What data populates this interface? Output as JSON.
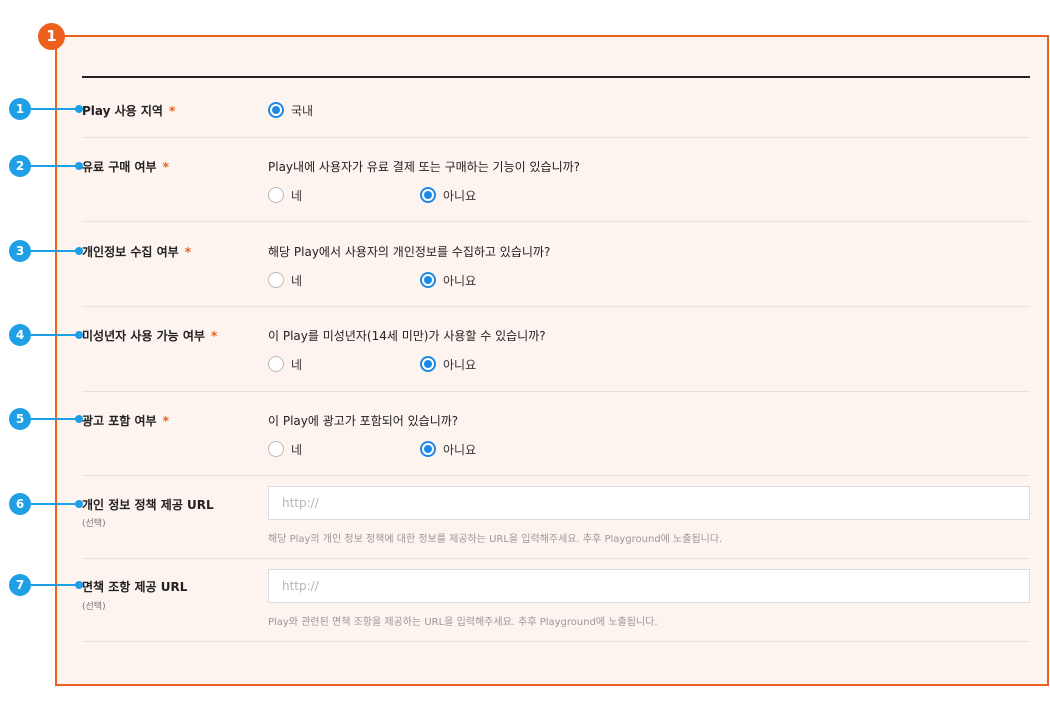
{
  "frame_badge": "1",
  "fields": {
    "region": {
      "num": "1",
      "label": "Play 사용 지역",
      "required_mark": "*",
      "option": "국내",
      "selected": true
    },
    "paid": {
      "num": "2",
      "label": "유료 구매 여부",
      "required_mark": "*",
      "question": "Play내에 사용자가 유료 결제 또는 구매하는 기능이 있습니까?",
      "options": [
        "네",
        "아니요"
      ],
      "selected": "아니요"
    },
    "privacy": {
      "num": "3",
      "label": "개인정보 수집 여부",
      "required_mark": "*",
      "question": "해당 Play에서 사용자의 개인정보를 수집하고 있습니까?",
      "options": [
        "네",
        "아니요"
      ],
      "selected": "아니요"
    },
    "minor": {
      "num": "4",
      "label": "미성년자 사용 가능 여부",
      "required_mark": "*",
      "question": "이 Play를 미성년자(14세 미만)가 사용할 수 있습니까?",
      "options": [
        "네",
        "아니요"
      ],
      "selected": "아니요"
    },
    "ads": {
      "num": "5",
      "label": "광고 포함 여부",
      "required_mark": "*",
      "question": "이 Play에 광고가 포함되어 있습니까?",
      "options": [
        "네",
        "아니요"
      ],
      "selected": "아니요"
    },
    "privacy_url": {
      "num": "6",
      "label": "개인 정보 정책 제공 URL",
      "sublabel": "(선택)",
      "placeholder": "http://",
      "value": "",
      "helper": "해당 Play의 개인 정보 정책에 대한 정보를 제공하는 URL을 입력해주세요. 추후 Playground에 노출됩니다."
    },
    "disclaimer_url": {
      "num": "7",
      "label": "면책 조항 제공 URL",
      "sublabel": "(선택)",
      "placeholder": "http://",
      "value": "",
      "helper": "Play와 관련된 면책 조항을 제공하는 URL을 입력해주세요. 추후 Playground에 노출됩니다."
    }
  },
  "colors": {
    "frame_border": "#ec5f1d",
    "frame_bg": "#fdf3ef",
    "callout": "#1e9fe6",
    "radio_selected": "#1e88e5",
    "required": "#ec5f1d"
  }
}
